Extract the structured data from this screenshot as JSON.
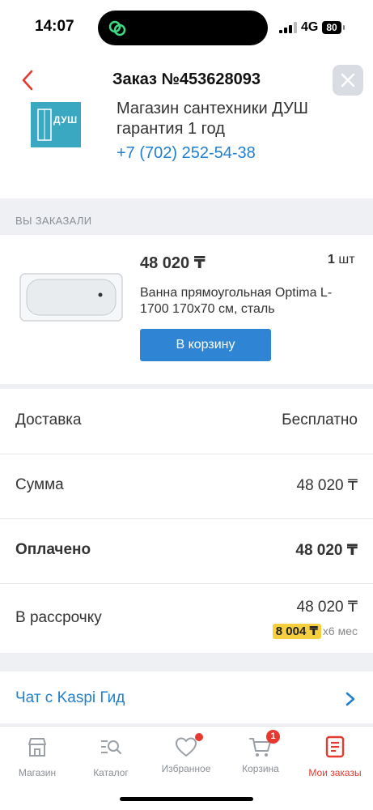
{
  "status_bar": {
    "time": "14:07",
    "network": "4G",
    "battery": "80"
  },
  "header": {
    "title": "Заказ №453628093"
  },
  "shop": {
    "logo_text": "ДУШ",
    "name": "Магазин сантехники ДУШ гарантия 1 год",
    "phone": "+7 (702) 252-54-38"
  },
  "ordered_section": {
    "label": "ВЫ ЗАКАЗАЛИ"
  },
  "product": {
    "price": "48 020 ₸",
    "quantity": "1",
    "quantity_unit": "шт",
    "name": "Ванна прямоугольная Optima L-1700 170x70 см, сталь",
    "cart_button": "В корзину"
  },
  "summary": {
    "delivery_label": "Доставка",
    "delivery_value": "Бесплатно",
    "sum_label": "Сумма",
    "sum_value": "48 020 ₸",
    "paid_label": "Оплачено",
    "paid_value": "48 020 ₸",
    "installment_label": "В рассрочку",
    "installment_value": "48 020 ₸",
    "installment_monthly": "8 004 ₸",
    "installment_term": "x6 мес"
  },
  "chat": {
    "label": "Чат с Kaspi Гид"
  },
  "tabbar": {
    "tabs": [
      {
        "label": "Магазин",
        "icon": "shop-icon"
      },
      {
        "label": "Каталог",
        "icon": "catalog-search-icon"
      },
      {
        "label": "Избранное",
        "icon": "heart-icon"
      },
      {
        "label": "Корзина",
        "icon": "cart-icon",
        "badge": "1"
      },
      {
        "label": "Мои заказы",
        "icon": "orders-icon"
      }
    ]
  },
  "colors": {
    "accent": "#e6392f",
    "link": "#1f7fd0",
    "button": "#2f84d4",
    "installment": "#f5cf3e"
  }
}
